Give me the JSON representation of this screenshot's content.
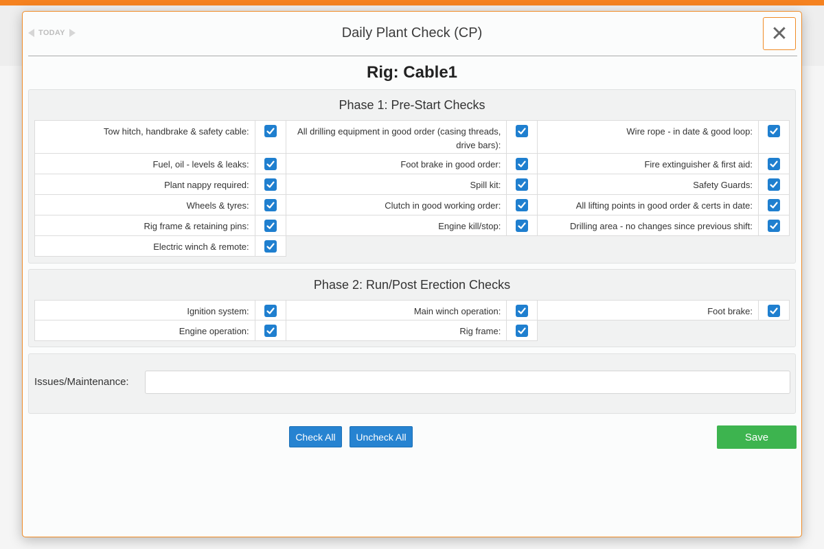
{
  "nav": {
    "today_label": "TODAY"
  },
  "modal": {
    "title": "Daily Plant Check (CP)",
    "close_label": "✕"
  },
  "rig": {
    "title": "Rig: Cable1"
  },
  "phase1": {
    "title": "Phase 1: Pre-Start Checks",
    "items": [
      {
        "label": "Tow hitch, handbrake & safety cable:",
        "checked": true
      },
      {
        "label": "All drilling equipment in good order (casing threads, drive bars):",
        "checked": true
      },
      {
        "label": "Wire rope - in date & good loop:",
        "checked": true
      },
      {
        "label": "Fuel, oil - levels & leaks:",
        "checked": true
      },
      {
        "label": "Foot brake in good order:",
        "checked": true
      },
      {
        "label": "Fire extinguisher & first aid:",
        "checked": true
      },
      {
        "label": "Plant nappy required:",
        "checked": true
      },
      {
        "label": "Spill kit:",
        "checked": true
      },
      {
        "label": "Safety Guards:",
        "checked": true
      },
      {
        "label": "Wheels & tyres:",
        "checked": true
      },
      {
        "label": "Clutch in good working order:",
        "checked": true
      },
      {
        "label": "All lifting points in good order & certs in date:",
        "checked": true
      },
      {
        "label": "Rig frame & retaining pins:",
        "checked": true
      },
      {
        "label": "Engine kill/stop:",
        "checked": true
      },
      {
        "label": "Drilling area - no changes since previous shift:",
        "checked": true
      },
      {
        "label": "Electric winch & remote:",
        "checked": true
      }
    ]
  },
  "phase2": {
    "title": "Phase 2: Run/Post Erection Checks",
    "items": [
      {
        "label": "Ignition system:",
        "checked": true
      },
      {
        "label": "Main winch operation:",
        "checked": true
      },
      {
        "label": "Foot brake:",
        "checked": true
      },
      {
        "label": "Engine operation:",
        "checked": true
      },
      {
        "label": "Rig frame:",
        "checked": true
      }
    ]
  },
  "issues": {
    "label": "Issues/Maintenance:",
    "value": ""
  },
  "actions": {
    "check_all": "Check All",
    "uncheck_all": "Uncheck All",
    "save": "Save"
  },
  "colors": {
    "accent": "#f58220",
    "checkbox": "#1f7fcf",
    "button": "#2683d1",
    "save": "#3db44f"
  }
}
